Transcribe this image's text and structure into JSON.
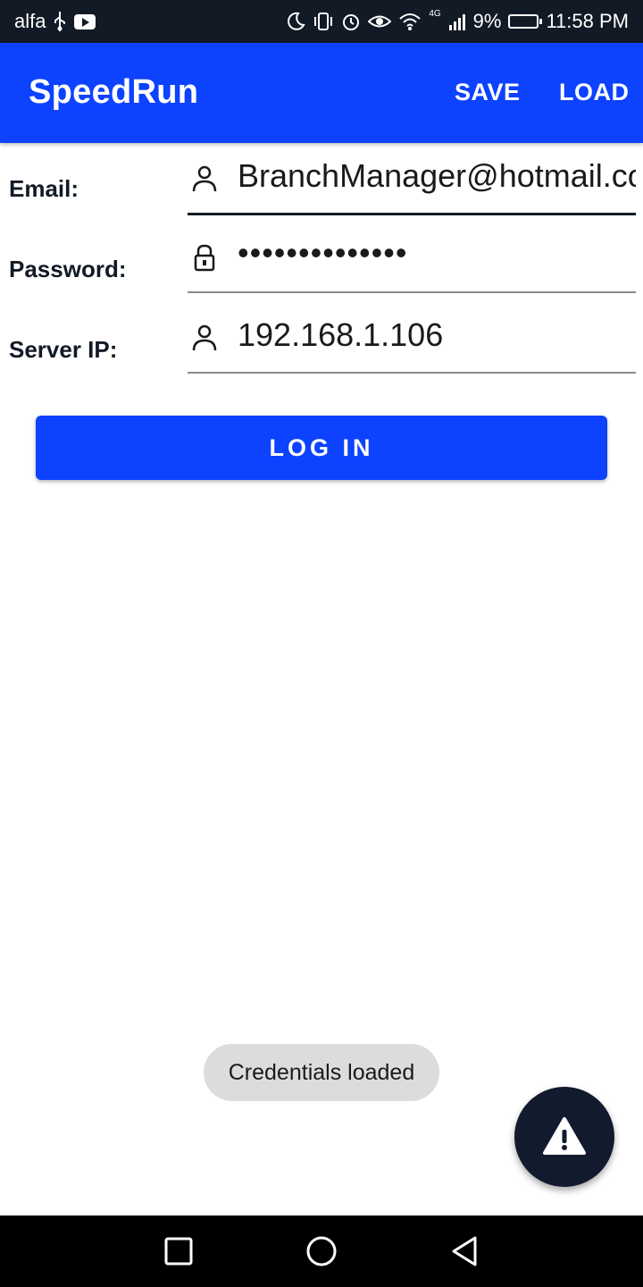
{
  "status_bar": {
    "carrier": "alfa",
    "battery": "9%",
    "network": "4G",
    "time": "11:58 PM",
    "icons": [
      "usb-icon",
      "youtube-icon",
      "moon-icon",
      "vibrate-icon",
      "alarm-icon",
      "eye-icon",
      "wifi-icon",
      "signal-icon",
      "battery-icon"
    ]
  },
  "app_bar": {
    "title": "SpeedRun",
    "actions": {
      "save": "SAVE",
      "load": "LOAD"
    }
  },
  "form": {
    "email": {
      "label": "Email:",
      "value": "BranchManager@hotmail.com",
      "icon": "person-icon"
    },
    "password": {
      "label": "Password:",
      "value": "••••••••••••••",
      "icon": "lock-icon"
    },
    "server_ip": {
      "label": "Server IP:",
      "value": "192.168.1.106",
      "icon": "person-icon"
    },
    "login_label": "LOG IN"
  },
  "toast": {
    "message": "Credentials loaded"
  },
  "fab": {
    "icon": "warning-icon"
  },
  "nav_bar": {
    "icons": [
      "recent-apps-icon",
      "home-icon",
      "back-icon"
    ]
  },
  "colors": {
    "primary": "#0d42ff",
    "dark": "#121a26",
    "toast_bg": "#dcdcdc"
  }
}
